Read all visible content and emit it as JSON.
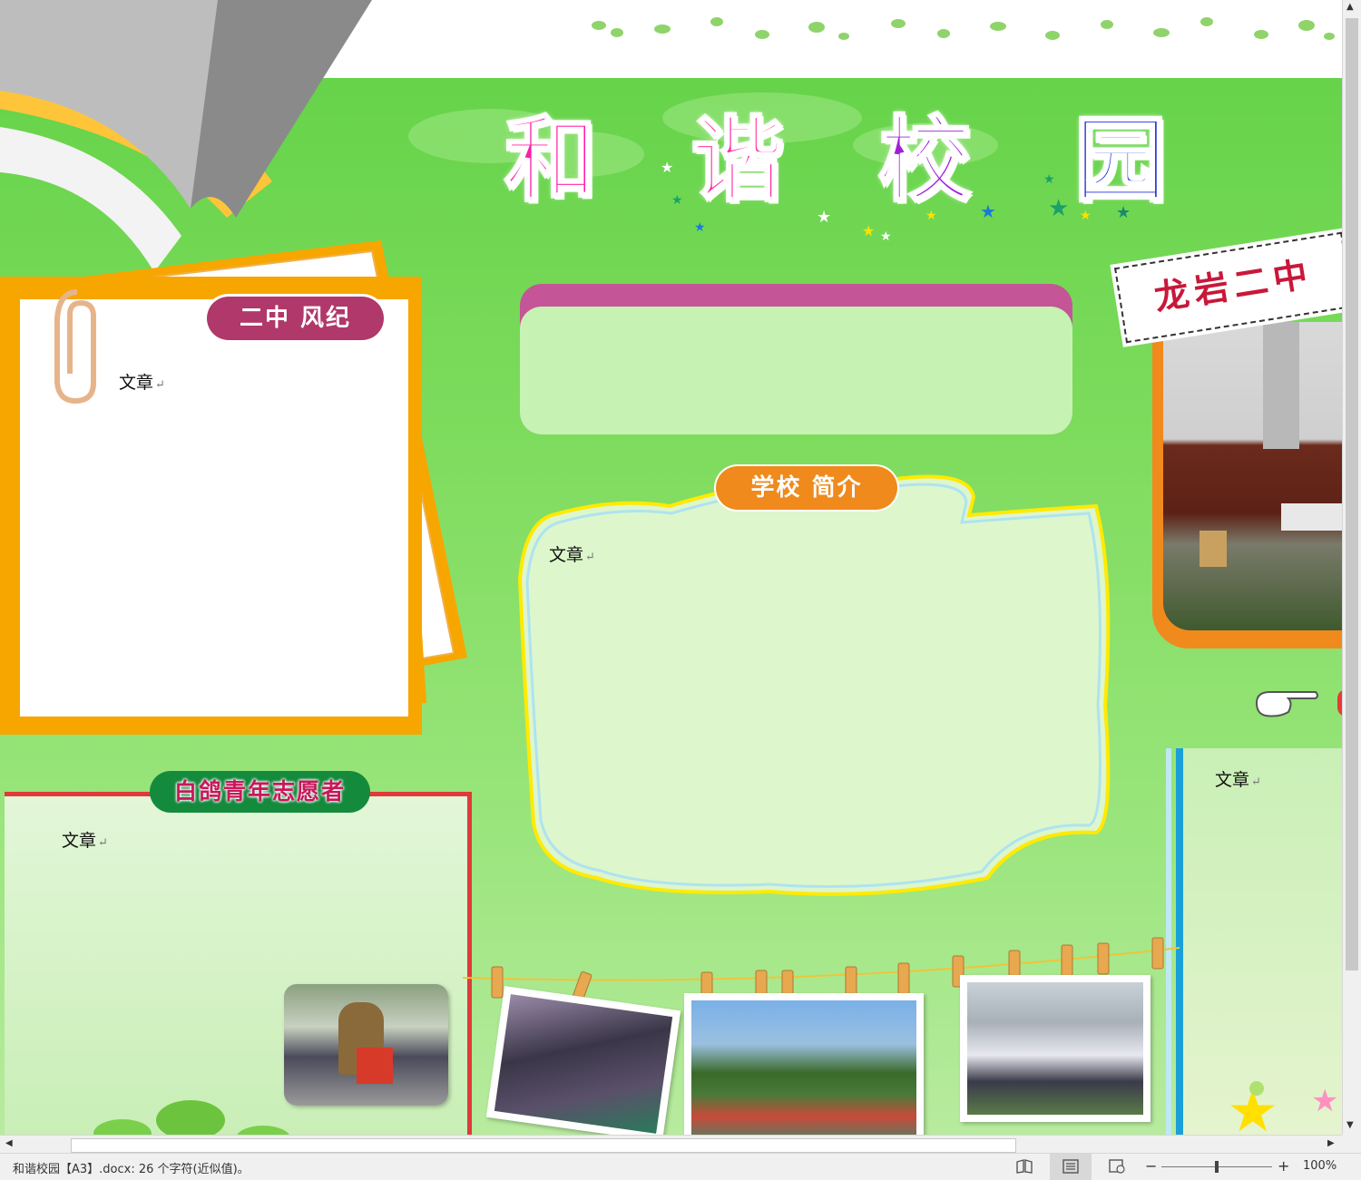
{
  "poster": {
    "title_chars": [
      "和",
      "谐",
      "校",
      "园"
    ],
    "title_colors": [
      "#ff1ea8",
      "#ff2ea0",
      "#a020d8",
      "#1a2ad8"
    ],
    "section_fengji": "二中 风纪",
    "section_intro": "学校 简介",
    "section_volunteer": "白鸽青年志愿者",
    "school_sign": "龙岩二中",
    "article_placeholder": "文章",
    "return_mark": "↵"
  },
  "colors": {
    "green_bg": "#7fdc5e",
    "fengji_label": "#b0386a",
    "intro_label": "#f08a1c",
    "volunteer_label": "#148a3c",
    "volunteer_text": "#c8185a",
    "top_box_band": "#c45597",
    "right_col_border": "#1aa0d8"
  },
  "status": {
    "doc_info": "和谐校园【A3】.docx: 26 个字符(近似值)。",
    "zoom": "100%",
    "zoom_minus": "−",
    "zoom_plus": "+",
    "zoom_level": 0.5
  },
  "icons": {
    "view_read": "book-icon",
    "view_print": "page-layout-icon",
    "view_web": "web-layout-icon",
    "pointing_hand": "pointing-hand-icon",
    "paperclip": "paperclip-icon"
  }
}
